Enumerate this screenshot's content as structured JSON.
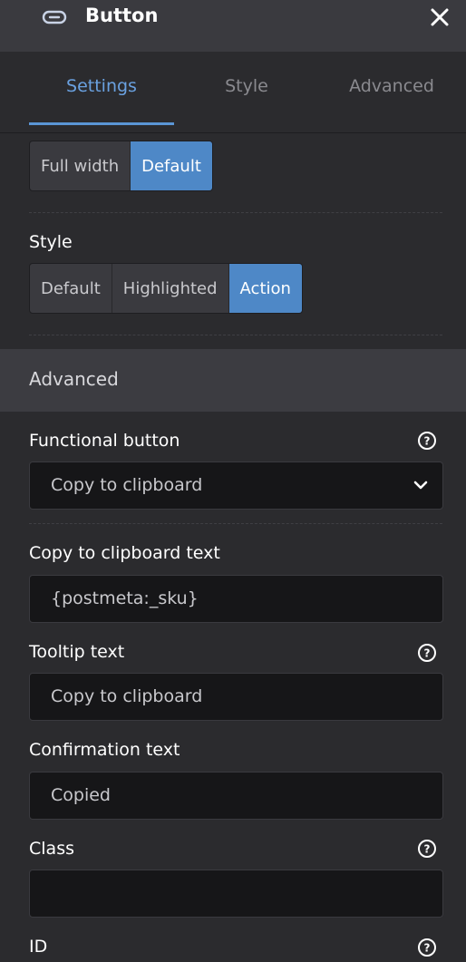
{
  "header": {
    "title": "Button",
    "icon": "button-icon",
    "close_icon": "close-icon"
  },
  "tabs": [
    {
      "label": "Settings",
      "active": true
    },
    {
      "label": "Style",
      "active": false
    },
    {
      "label": "Advanced",
      "active": false
    }
  ],
  "width_options": [
    {
      "label": "Full width",
      "active": false
    },
    {
      "label": "Default",
      "active": true
    }
  ],
  "style": {
    "label": "Style",
    "options": [
      {
        "label": "Default",
        "active": false
      },
      {
        "label": "Highlighted",
        "active": false
      },
      {
        "label": "Action",
        "active": true
      }
    ]
  },
  "advanced": {
    "title": "Advanced",
    "functional_button": {
      "label": "Functional button",
      "value": "Copy to clipboard"
    },
    "copy_text": {
      "label": "Copy to clipboard text",
      "value": "{postmeta:_sku}"
    },
    "tooltip": {
      "label": "Tooltip text",
      "value": "Copy to clipboard"
    },
    "confirmation": {
      "label": "Confirmation text",
      "value": "Copied"
    },
    "class": {
      "label": "Class",
      "value": ""
    },
    "id": {
      "label": "ID"
    }
  },
  "colors": {
    "accent": "#4e88c7",
    "tab_active": "#6aa1e0",
    "panel": "#2b2b2e",
    "input_bg": "#161618"
  }
}
